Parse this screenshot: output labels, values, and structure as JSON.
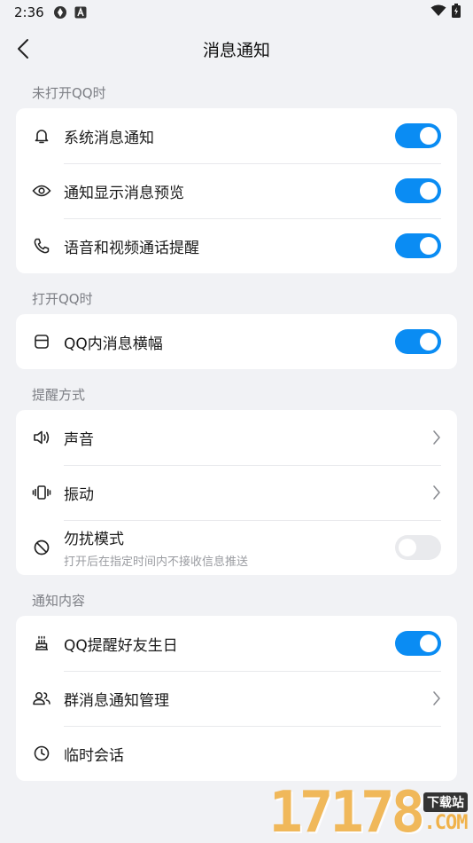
{
  "status_bar": {
    "time": "2:36"
  },
  "nav": {
    "title": "消息通知"
  },
  "sections": [
    {
      "label": "未打开QQ时",
      "rows": [
        {
          "label": "系统消息通知",
          "icon": "bell-icon",
          "control": "toggle",
          "on": true
        },
        {
          "label": "通知显示消息预览",
          "icon": "eye-icon",
          "control": "toggle",
          "on": true
        },
        {
          "label": "语音和视频通话提醒",
          "icon": "phone-icon",
          "control": "toggle",
          "on": true
        }
      ]
    },
    {
      "label": "打开QQ时",
      "rows": [
        {
          "label": "QQ内消息横幅",
          "icon": "banner-icon",
          "control": "toggle",
          "on": true
        }
      ]
    },
    {
      "label": "提醒方式",
      "rows": [
        {
          "label": "声音",
          "icon": "speaker-icon",
          "control": "chevron"
        },
        {
          "label": "振动",
          "icon": "vibrate-icon",
          "control": "chevron"
        },
        {
          "label": "勿扰模式",
          "sublabel": "打开后在指定时间内不接收信息推送",
          "icon": "do-not-disturb-icon",
          "control": "toggle",
          "on": false
        }
      ]
    },
    {
      "label": "通知内容",
      "rows": [
        {
          "label": "QQ提醒好友生日",
          "icon": "cake-icon",
          "control": "toggle",
          "on": true
        },
        {
          "label": "群消息通知管理",
          "icon": "group-icon",
          "control": "chevron"
        },
        {
          "label": "临时会话",
          "icon": "clock-icon",
          "control": "none"
        }
      ]
    }
  ],
  "watermark": {
    "digits": "17178",
    "badge": "下载站",
    "suffix": ".COM"
  },
  "colors": {
    "accent": "#0a8cf3",
    "background": "#f1f2f5",
    "card": "#ffffff",
    "section_label": "#7d7f85"
  }
}
